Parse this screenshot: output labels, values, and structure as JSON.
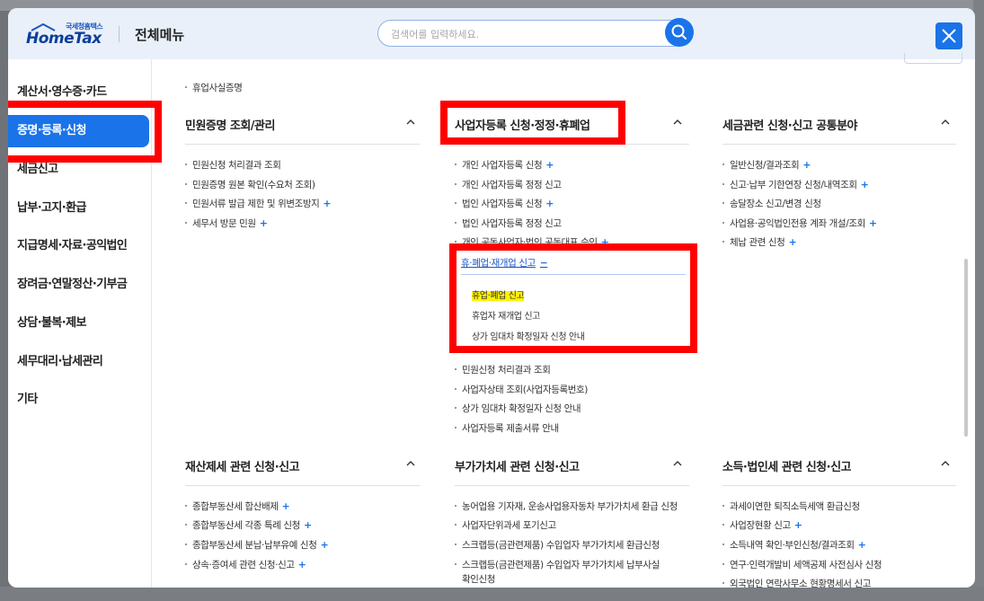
{
  "header": {
    "logo_small": "국세청홈택스",
    "logo_main": "HomeTax",
    "title": "전체메뉴",
    "search_placeholder": "검색어를 입력하세요."
  },
  "sidebar": {
    "items": [
      {
        "label": "계산서·영수증·카드"
      },
      {
        "label": "증명·등록·신청",
        "active": true
      },
      {
        "label": "세금신고"
      },
      {
        "label": "납부·고지·환급"
      },
      {
        "label": "지급명세·자료·공익법인"
      },
      {
        "label": "장려금·연말정산·기부금"
      },
      {
        "label": "상담·불복·제보"
      },
      {
        "label": "세무대리·납세관리"
      },
      {
        "label": "기타"
      }
    ]
  },
  "top_item": "휴업사실증명",
  "columns": [
    {
      "title": "민원증명 조회/관리",
      "items": [
        {
          "label": "민원신청 처리결과 조회",
          "plus": false
        },
        {
          "label": "민원증명 원본 확인(수요처 조회)",
          "plus": false
        },
        {
          "label": "민원서류 발급 제한 및 위변조방지",
          "plus": true
        },
        {
          "label": "세무서 방문 민원",
          "plus": true
        }
      ]
    },
    {
      "title": "사업자등록 신청·정정·휴폐업",
      "items": [
        {
          "label": "개인 사업자등록 신청",
          "plus": true
        },
        {
          "label": "개인 사업자등록 정정 신고",
          "plus": false
        },
        {
          "label": "법인 사업자등록 신청",
          "plus": true
        },
        {
          "label": "법인 사업자등록 정정 신고",
          "plus": false
        },
        {
          "label": "개인 공동사업자·법인 공동대표 승인",
          "plus": true
        }
      ],
      "expanded": {
        "label": "휴·폐업·재개업 신고",
        "sub_items": [
          {
            "label": "휴업·폐업 신고",
            "highlight": true
          },
          {
            "label": "휴업자 재개업 신고",
            "highlight": false
          },
          {
            "label": "상가 임대차 확정일자 신청 안내",
            "highlight": false
          }
        ]
      },
      "after_items": [
        {
          "label": "민원신청 처리결과 조회"
        },
        {
          "label": "사업자상태 조회(사업자등록번호)"
        },
        {
          "label": "상가 임대차 확정일자 신청 안내"
        },
        {
          "label": "사업자등록 제출서류 안내"
        }
      ]
    },
    {
      "title": "세금관련 신청·신고 공통분야",
      "items": [
        {
          "label": "일반신청/결과조회",
          "plus": true
        },
        {
          "label": "신고·납부 기한연장 신청/내역조회",
          "plus": true
        },
        {
          "label": "송달장소 신고/변경 신청",
          "plus": false
        },
        {
          "label": "사업용·공익법인전용 계좌 개설/조회",
          "plus": true
        },
        {
          "label": "체납 관련 신청",
          "plus": true
        }
      ]
    },
    {
      "title": "재산제세 관련 신청·신고",
      "items": [
        {
          "label": "종합부동산세 합산배제",
          "plus": true
        },
        {
          "label": "종합부동산세 각종 특례 신청",
          "plus": true
        },
        {
          "label": "종합부동산세 분납·납부유예 신청",
          "plus": true
        },
        {
          "label": "상속·증여세 관련 신청·신고",
          "plus": true
        }
      ]
    },
    {
      "title": "부가가치세 관련 신청·신고",
      "items": [
        {
          "label": "농어업용 기자재, 운송사업용자동차 부가가치세 환급 신청",
          "plus": false
        },
        {
          "label": "사업자단위과세 포기신고",
          "plus": false
        },
        {
          "label": "스크랩등(금관련제품) 수입업자 부가가치세 환급신청",
          "plus": false
        },
        {
          "label": "스크랩등(금관련제품) 수입업자 부가가치세 납부사실",
          "plus": false,
          "line2": "확인신청"
        }
      ]
    },
    {
      "title": "소득·법인세 관련 신청·신고",
      "items": [
        {
          "label": "과세이연한 퇴직소득세액 환급신청",
          "plus": false
        },
        {
          "label": "사업장현황 신고",
          "plus": true
        },
        {
          "label": "소득내역 확인·부인신청/결과조회",
          "plus": true
        },
        {
          "label": "연구·인력개발비 세액공제 사전심사 신청",
          "plus": false
        },
        {
          "label": "외국법인 연락사무소 현황명세서 신고",
          "plus": false
        }
      ]
    }
  ],
  "colors": {
    "accent": "#1a73e8",
    "annotation": "#ff0000",
    "highlight": "#fff200"
  }
}
